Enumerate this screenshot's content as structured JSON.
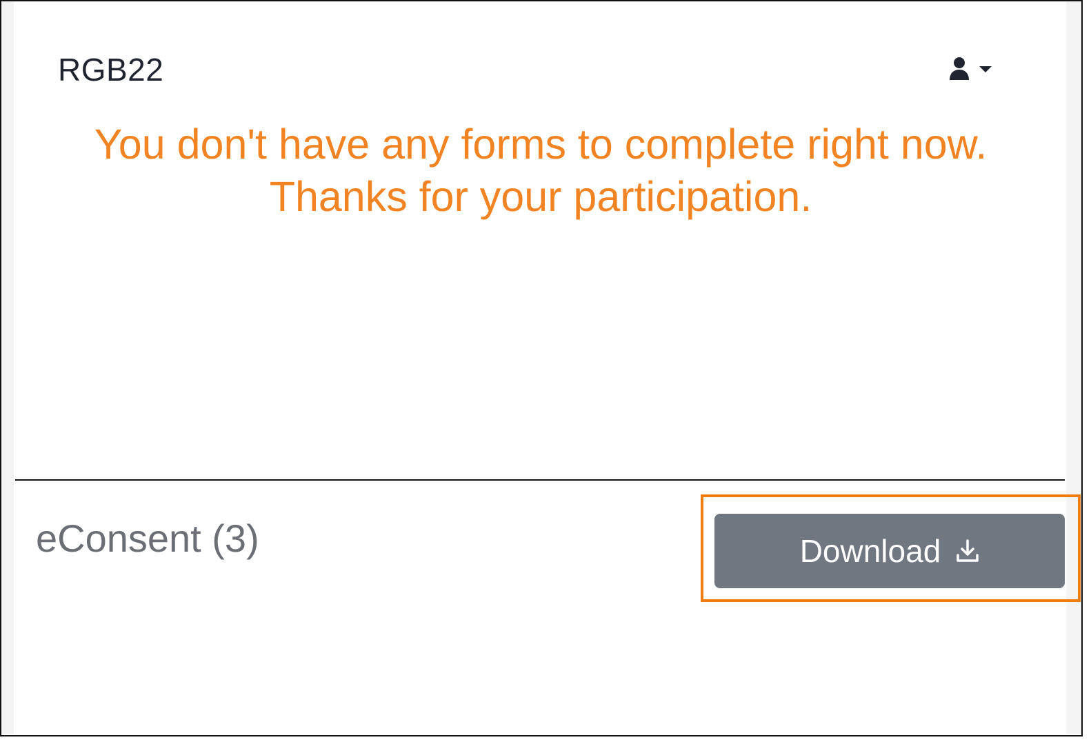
{
  "header": {
    "brand": "RGB22",
    "user_menu": {
      "icon": "user-icon",
      "caret": "caret-down-icon"
    }
  },
  "notice": {
    "line1": "You don't have any forms to complete right now.",
    "line2": "Thanks for your participation.",
    "color": "#f28322"
  },
  "econsent": {
    "title": "eConsent (3)",
    "download_label": "Download",
    "download_icon": "download-icon",
    "button_color": "#717780",
    "highlight_color": "#f07d0f"
  }
}
